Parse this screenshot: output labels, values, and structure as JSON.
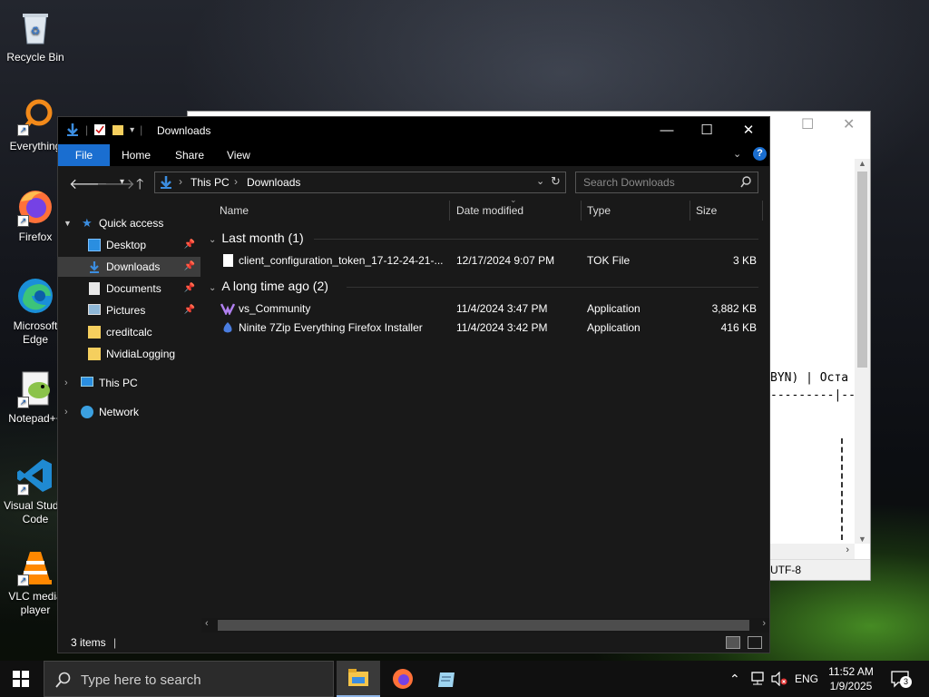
{
  "desktop": {
    "icons": [
      {
        "label": "Recycle Bin"
      },
      {
        "label": "Everything"
      },
      {
        "label": "Firefox"
      },
      {
        "label": "Microsoft Edge"
      },
      {
        "label": "Notepad++"
      },
      {
        "label": "Visual Studio Code"
      },
      {
        "label": "VLC media player"
      }
    ]
  },
  "notepad": {
    "text_line1": "BYN) | Оста",
    "text_line2": "---------|--",
    "status_encoding": "UTF-8"
  },
  "explorer": {
    "title": "Downloads",
    "ribbon": {
      "file": "File",
      "home": "Home",
      "share": "Share",
      "view": "View"
    },
    "breadcrumb": [
      "This PC",
      "Downloads"
    ],
    "search_placeholder": "Search Downloads",
    "nav": {
      "quick_access": "Quick access",
      "items": [
        "Desktop",
        "Downloads",
        "Documents",
        "Pictures",
        "creditcalc",
        "NvidiaLogging"
      ],
      "this_pc": "This PC",
      "network": "Network"
    },
    "columns": {
      "name": "Name",
      "date": "Date modified",
      "type": "Type",
      "size": "Size"
    },
    "groups": [
      {
        "label": "Last month (1)",
        "files": [
          {
            "name": "client_configuration_token_17-12-24-21-...",
            "date": "12/17/2024 9:07 PM",
            "type": "TOK File",
            "size": "3 KB"
          }
        ]
      },
      {
        "label": "A long time ago (2)",
        "files": [
          {
            "name": "vs_Community",
            "date": "11/4/2024 3:47 PM",
            "type": "Application",
            "size": "3,882 KB"
          },
          {
            "name": "Ninite 7Zip Everything Firefox Installer",
            "date": "11/4/2024 3:42 PM",
            "type": "Application",
            "size": "416 KB"
          }
        ]
      }
    ],
    "status": "3 items"
  },
  "taskbar": {
    "search_placeholder": "Type here to search",
    "language": "ENG",
    "time": "11:52 AM",
    "date": "1/9/2025",
    "notification_count": "3"
  }
}
